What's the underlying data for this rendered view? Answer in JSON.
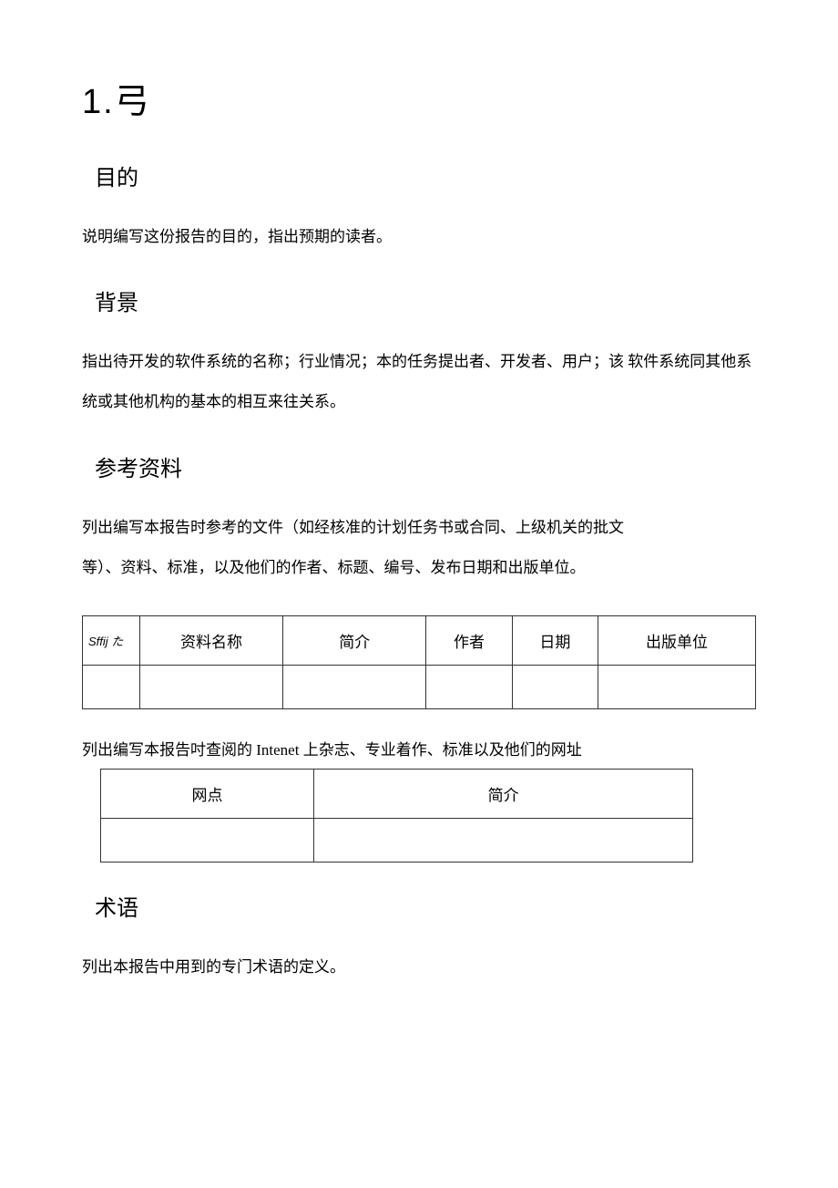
{
  "heading_main": "1.弓",
  "sections": {
    "purpose": {
      "title": "目的",
      "text": "说明编写这份报告的目的，指出预期的读者。"
    },
    "background": {
      "title": "背景",
      "text": "指出待开发的软件系统的名称；行业情况；本的任务提出者、开发者、用户；该 软件系统同其他系统或其他机构的基本的相互来往关系。"
    },
    "references": {
      "title": "参考资料",
      "text1": "列出编写本报告时参考的文件（如经核准的计划任务书或合同、上级机关的批文",
      "text2": "等）、资料、标准，以及他们的作者、标题、编号、发布日期和出版单位。",
      "table1_headers": {
        "h1": "Sffij た",
        "h2": "资料名称",
        "h3": "简介",
        "h4": "作者",
        "h5": "日期",
        "h6": "出版单位"
      },
      "text3": "列出编写本报告吋查阅的 Intenet 上杂志、专业着作、标准以及他们的网址",
      "table2_headers": {
        "h1": "网点",
        "h2": "简介"
      }
    },
    "terms": {
      "title": "术语",
      "text": "列出本报告中用到的专门术语的定义。"
    }
  }
}
